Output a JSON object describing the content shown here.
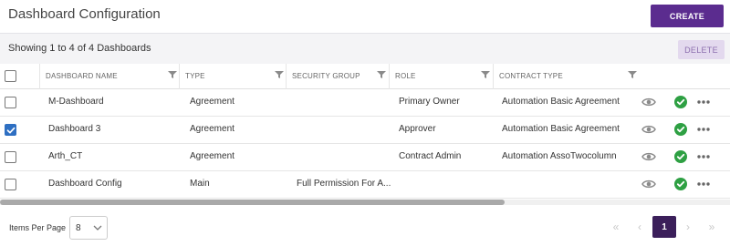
{
  "header": {
    "title": "Dashboard Configuration",
    "create_label": "CREATE"
  },
  "toolbar": {
    "showing_text": "Showing 1 to 4 of 4 Dashboards",
    "delete_label": "DELETE"
  },
  "table": {
    "columns": [
      "DASHBOARD NAME",
      "TYPE",
      "SECURITY GROUP",
      "ROLE",
      "CONTRACT TYPE"
    ],
    "rows": [
      {
        "checked": false,
        "name": "M-Dashboard",
        "type": "Agreement",
        "security_group": "",
        "role": "Primary Owner",
        "contract_type": "Automation Basic Agreement"
      },
      {
        "checked": true,
        "name": "Dashboard 3",
        "type": "Agreement",
        "security_group": "",
        "role": "Approver",
        "contract_type": "Automation Basic Agreement"
      },
      {
        "checked": false,
        "name": "Arth_CT",
        "type": "Agreement",
        "security_group": "",
        "role": "Contract Admin",
        "contract_type": "Automation AssoTwocolumn"
      },
      {
        "checked": false,
        "name": "Dashboard Config",
        "type": "Main",
        "security_group": "Full Permission For A...",
        "role": "",
        "contract_type": ""
      }
    ],
    "row_icons": [
      "eye-icon",
      "check-circle-icon",
      "more-icon"
    ]
  },
  "footer": {
    "items_per_page_label": "Items Per Page",
    "items_per_page_value": "8",
    "pager": {
      "first": "«",
      "prev": "‹",
      "current": "1",
      "next": "›",
      "last": "»"
    }
  },
  "colors": {
    "primary": "#5b2c8f",
    "primary_dark": "#3b1f5a",
    "delete_bg": "#e3d9ee",
    "checkbox_blue": "#2e6fc2",
    "status_green": "#2ea043"
  }
}
